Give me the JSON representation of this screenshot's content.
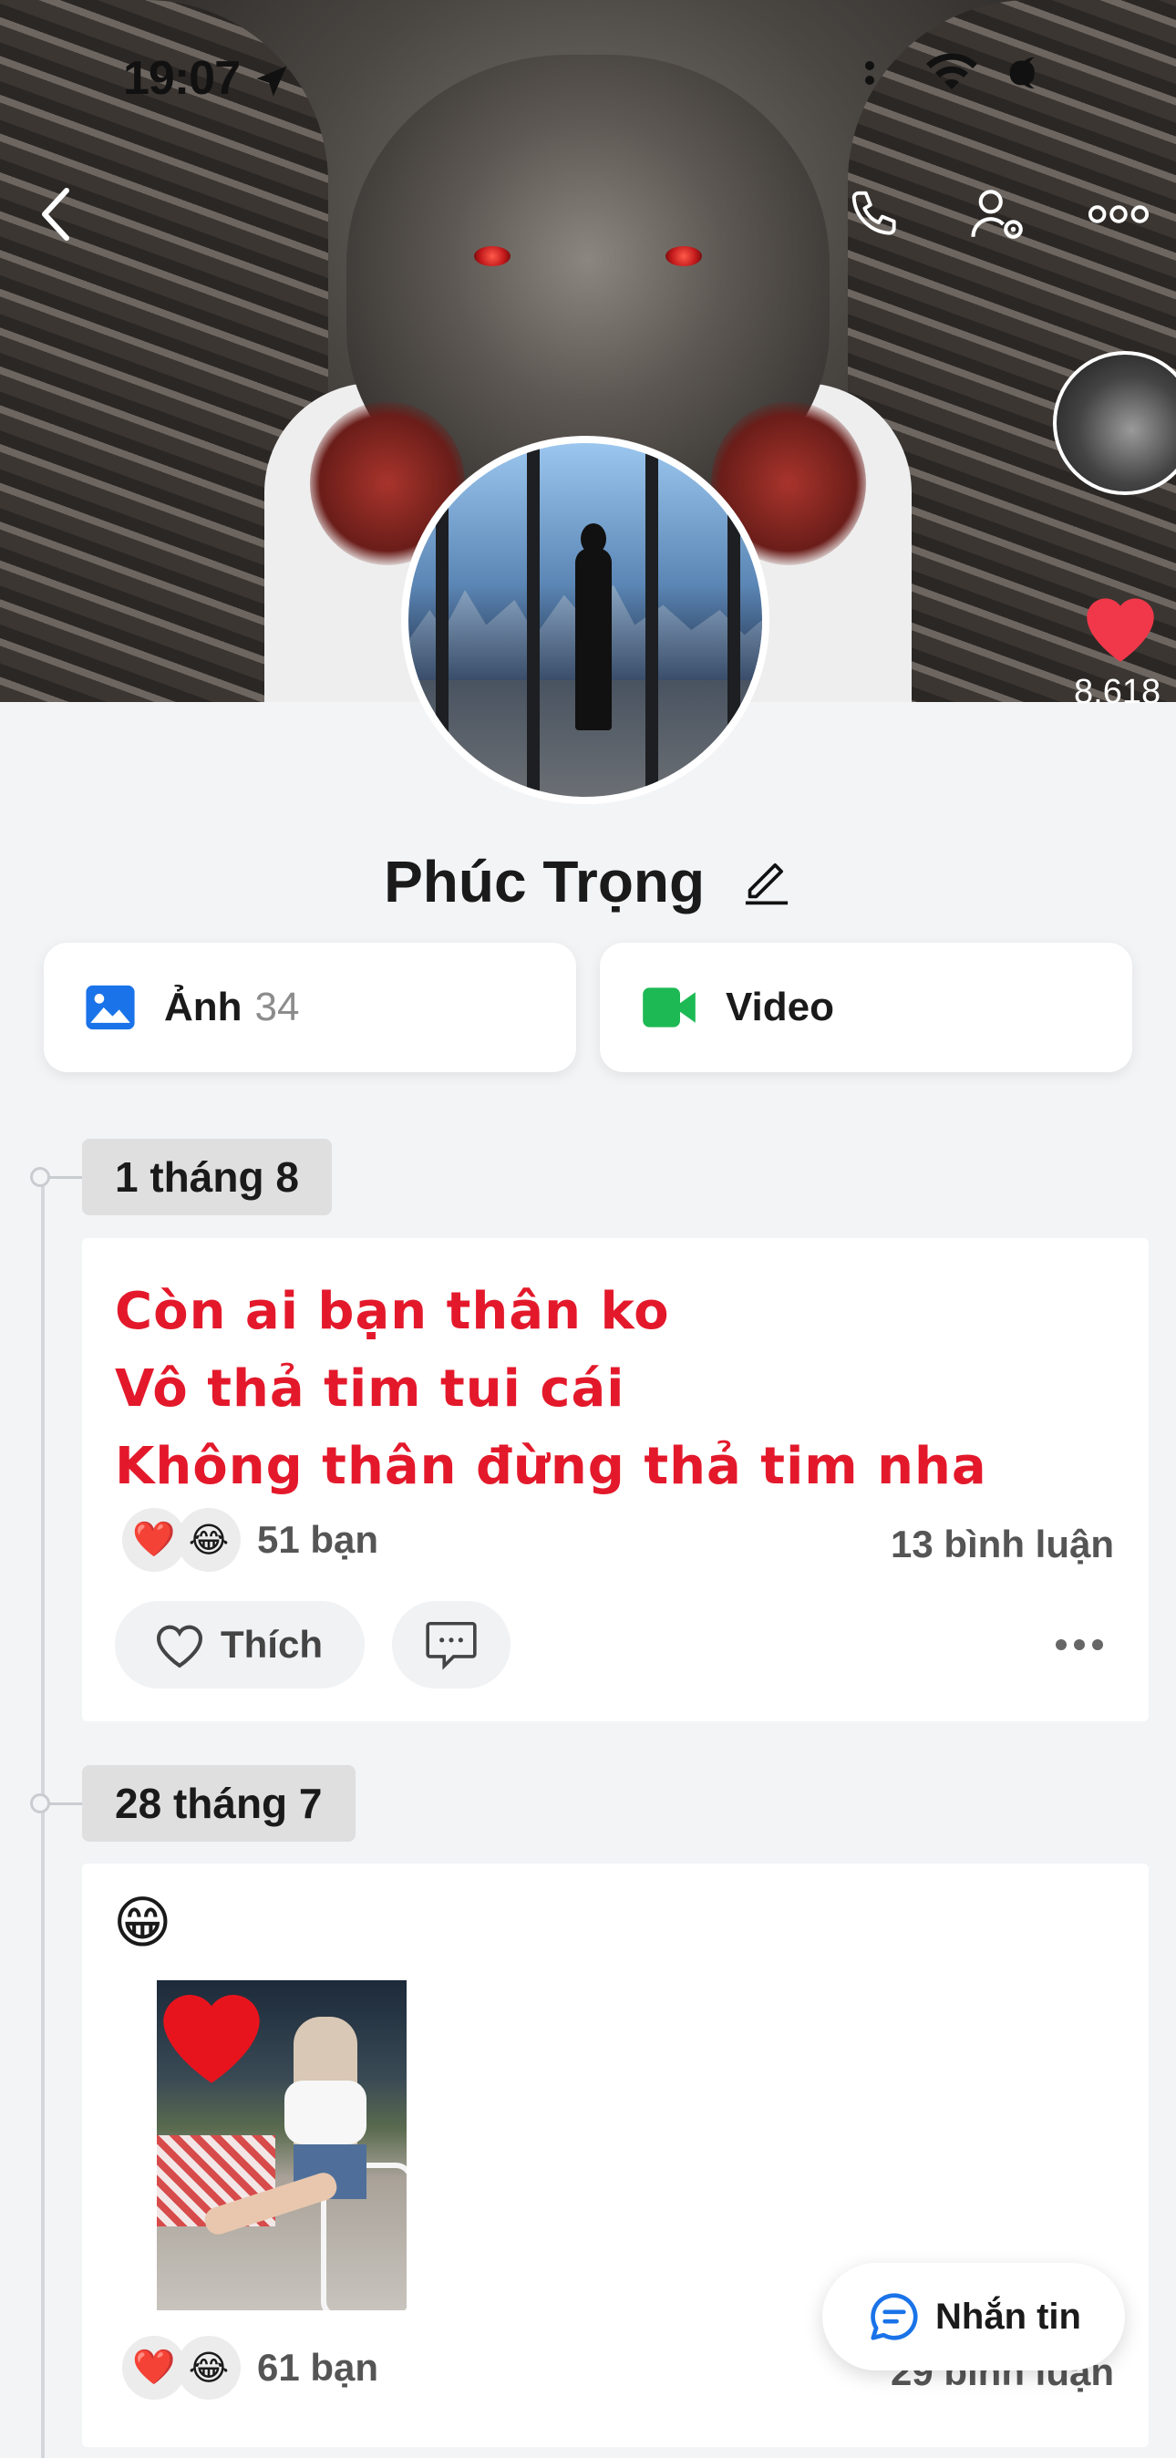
{
  "status_bar": {
    "time": "19:07"
  },
  "header": {
    "icons": [
      "back-icon",
      "phone-icon",
      "user-settings-icon",
      "more-icon"
    ],
    "cover_likes": "8.618"
  },
  "profile": {
    "name": "Phúc Trọng"
  },
  "media": {
    "photos_label": "Ảnh",
    "photos_count": "34",
    "video_label": "Video",
    "photo_icon_color": "#1a73e8",
    "video_icon_color": "#1db954"
  },
  "posts": [
    {
      "date": "1 tháng 8",
      "text": [
        "Còn ai bạn thân ko",
        "Vô thả tim tui cái",
        "Không thân đừng thả tim nha"
      ],
      "reactions_count": "51 bạn",
      "comments_count": "13 bình luận",
      "like_label": "Thích"
    },
    {
      "date": "28 tháng 7",
      "emoji": "😁",
      "reactions_count": "61 bạn",
      "comments_count": "29 bình luận"
    }
  ],
  "message_button": {
    "label": "Nhắn tin"
  },
  "colors": {
    "post_text": "#e3192b",
    "accent": "#1a73e8"
  }
}
